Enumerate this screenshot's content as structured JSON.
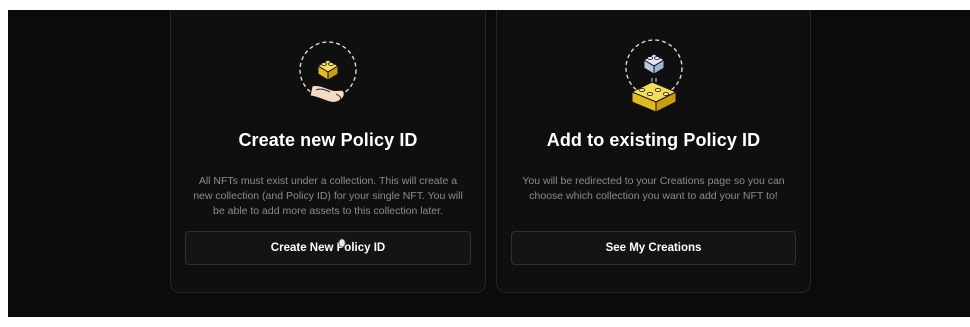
{
  "cards": [
    {
      "title": "Create new Policy ID",
      "description": "All NFTs must exist under a collection. This will create a new collection (and Policy ID) for your single NFT. You will be able to add more assets to this collection later.",
      "button_label": "Create New Policy ID",
      "icon": "hand-holding-brick-icon"
    },
    {
      "title": "Add to existing Policy ID",
      "description": "You will be redirected to your Creations page so you can choose which collection you want to add your NFT to!",
      "button_label": "See My Creations",
      "icon": "stacked-bricks-icon"
    }
  ],
  "colors": {
    "background": "#0b0b0c",
    "card": "#0f0f10",
    "brick_yellow": "#f2cd37",
    "brick_blue": "#c9d8ee"
  }
}
